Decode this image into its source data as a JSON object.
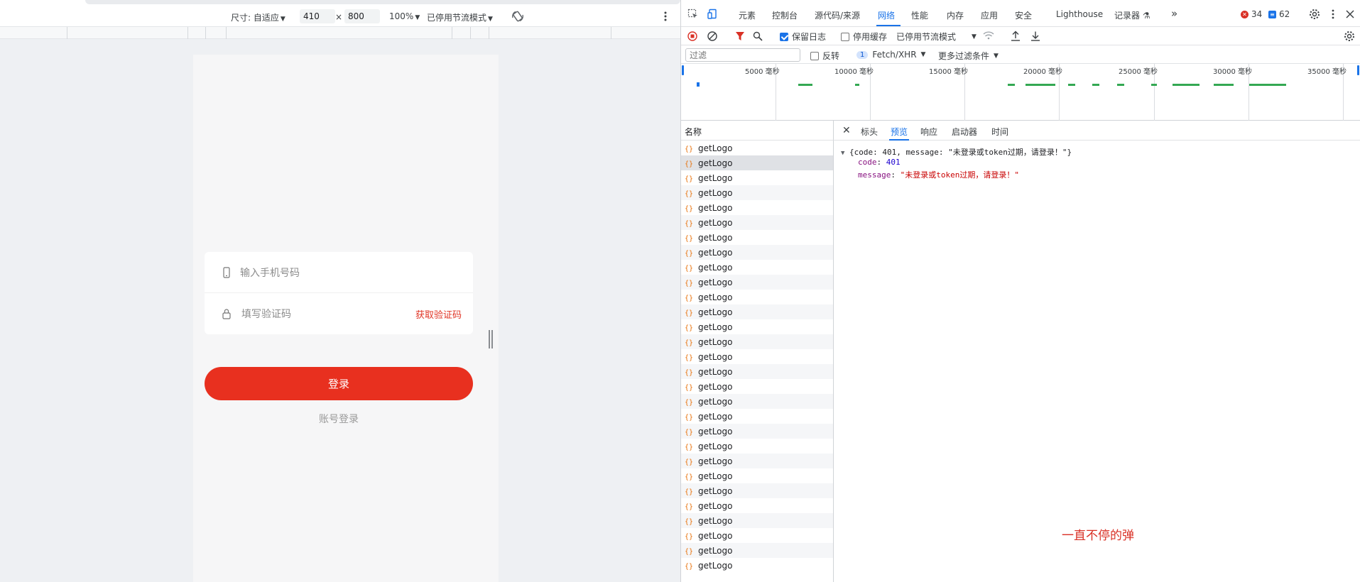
{
  "device_toolbar": {
    "size_label": "尺寸: 自适应",
    "width": "410",
    "times": "×",
    "height": "800",
    "zoom": "100%",
    "throttle": "已停用节流模式"
  },
  "phone_form": {
    "phone_placeholder": "输入手机号码",
    "code_placeholder": "填写验证码",
    "get_code": "获取验证码",
    "login_button": "登录",
    "account_login": "账号登录"
  },
  "devtools": {
    "tabs": [
      "元素",
      "控制台",
      "源代码/来源",
      "网络",
      "性能",
      "内存",
      "应用",
      "安全",
      "Lighthouse",
      "记录器"
    ],
    "active_tab": "网络",
    "more_tabs": "»",
    "error_count": "34",
    "message_count": "62",
    "toolbar": {
      "preserve_log": "保留日志",
      "disable_cache": "停用缓存",
      "throttle": "已停用节流模式"
    },
    "filter": {
      "placeholder": "过滤",
      "invert": "反转",
      "type_count": "1",
      "type_label": "Fetch/XHR",
      "more_filters": "更多过滤条件"
    },
    "overview_ticks": [
      "5000 毫秒",
      "10000 毫秒",
      "15000 毫秒",
      "20000 毫秒",
      "25000 毫秒",
      "30000 毫秒",
      "35000 毫秒"
    ],
    "name_header": "名称",
    "requests": [
      "getLogo",
      "getLogo",
      "getLogo",
      "getLogo",
      "getLogo",
      "getLogo",
      "getLogo",
      "getLogo",
      "getLogo",
      "getLogo",
      "getLogo",
      "getLogo",
      "getLogo",
      "getLogo",
      "getLogo",
      "getLogo",
      "getLogo",
      "getLogo",
      "getLogo",
      "getLogo",
      "getLogo",
      "getLogo",
      "getLogo",
      "getLogo",
      "getLogo",
      "getLogo",
      "getLogo",
      "getLogo",
      "getLogo"
    ],
    "detail_tabs": [
      "标头",
      "预览",
      "响应",
      "启动器",
      "时间"
    ],
    "active_detail_tab": "预览",
    "preview": {
      "summary": "{code: 401, message: \"未登录或token过期，请登录！\"}",
      "code_key": "code",
      "code_value": "401",
      "message_key": "message",
      "message_value": "\"未登录或token过期，请登录！\""
    },
    "annotation": "一直不停的弹"
  },
  "colors": {
    "accent": "#1a73e8",
    "login_red": "#e8301f",
    "annotation_red": "#d93025"
  }
}
